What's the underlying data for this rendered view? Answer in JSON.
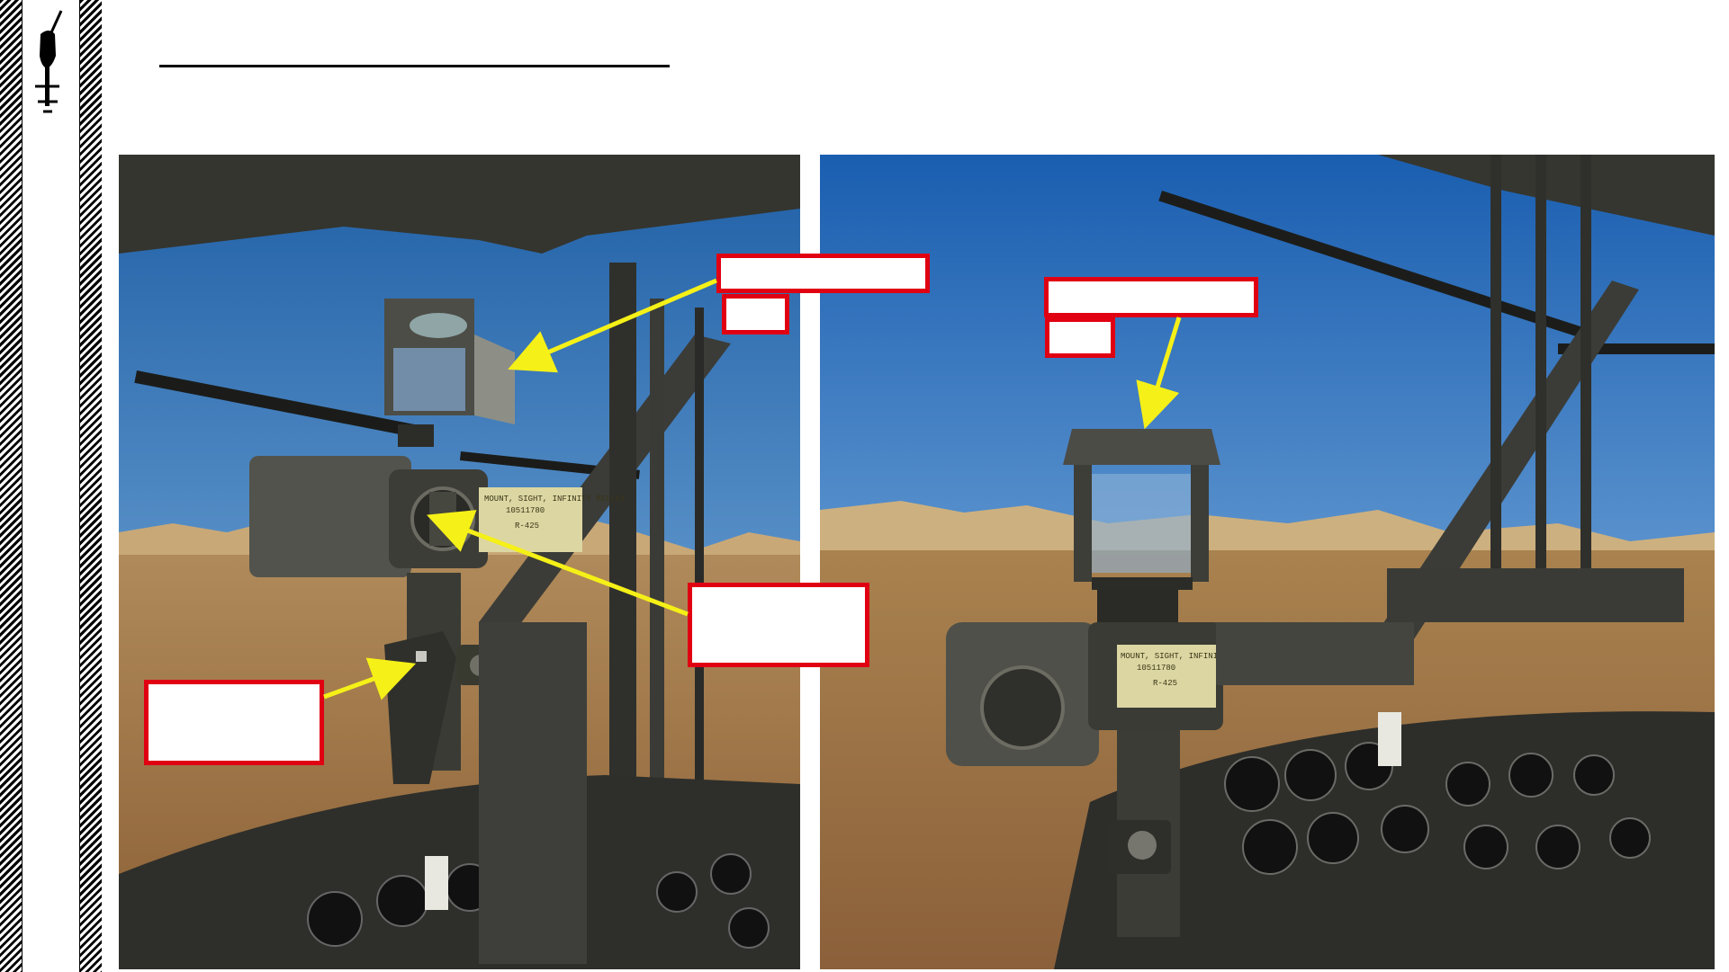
{
  "slide": {
    "background": "#ffffff",
    "title_rule_color": "#000000"
  },
  "logo": {
    "icon": "helicopter-icon"
  },
  "photos": {
    "left": {
      "placard_lines": [
        "MOUNT, SIGHT, INFINITY REFLEX",
        "10511780",
        "R-425"
      ]
    },
    "right": {
      "placard_lines": [
        "MOUNT, SIGHT, INFINITY REFLEX",
        "10511780",
        "R-425"
      ]
    }
  },
  "callouts": {
    "border_color": "#e00012",
    "arrow_color": "#f5f017",
    "items": [
      "",
      "",
      "",
      "",
      "",
      "",
      ""
    ]
  }
}
